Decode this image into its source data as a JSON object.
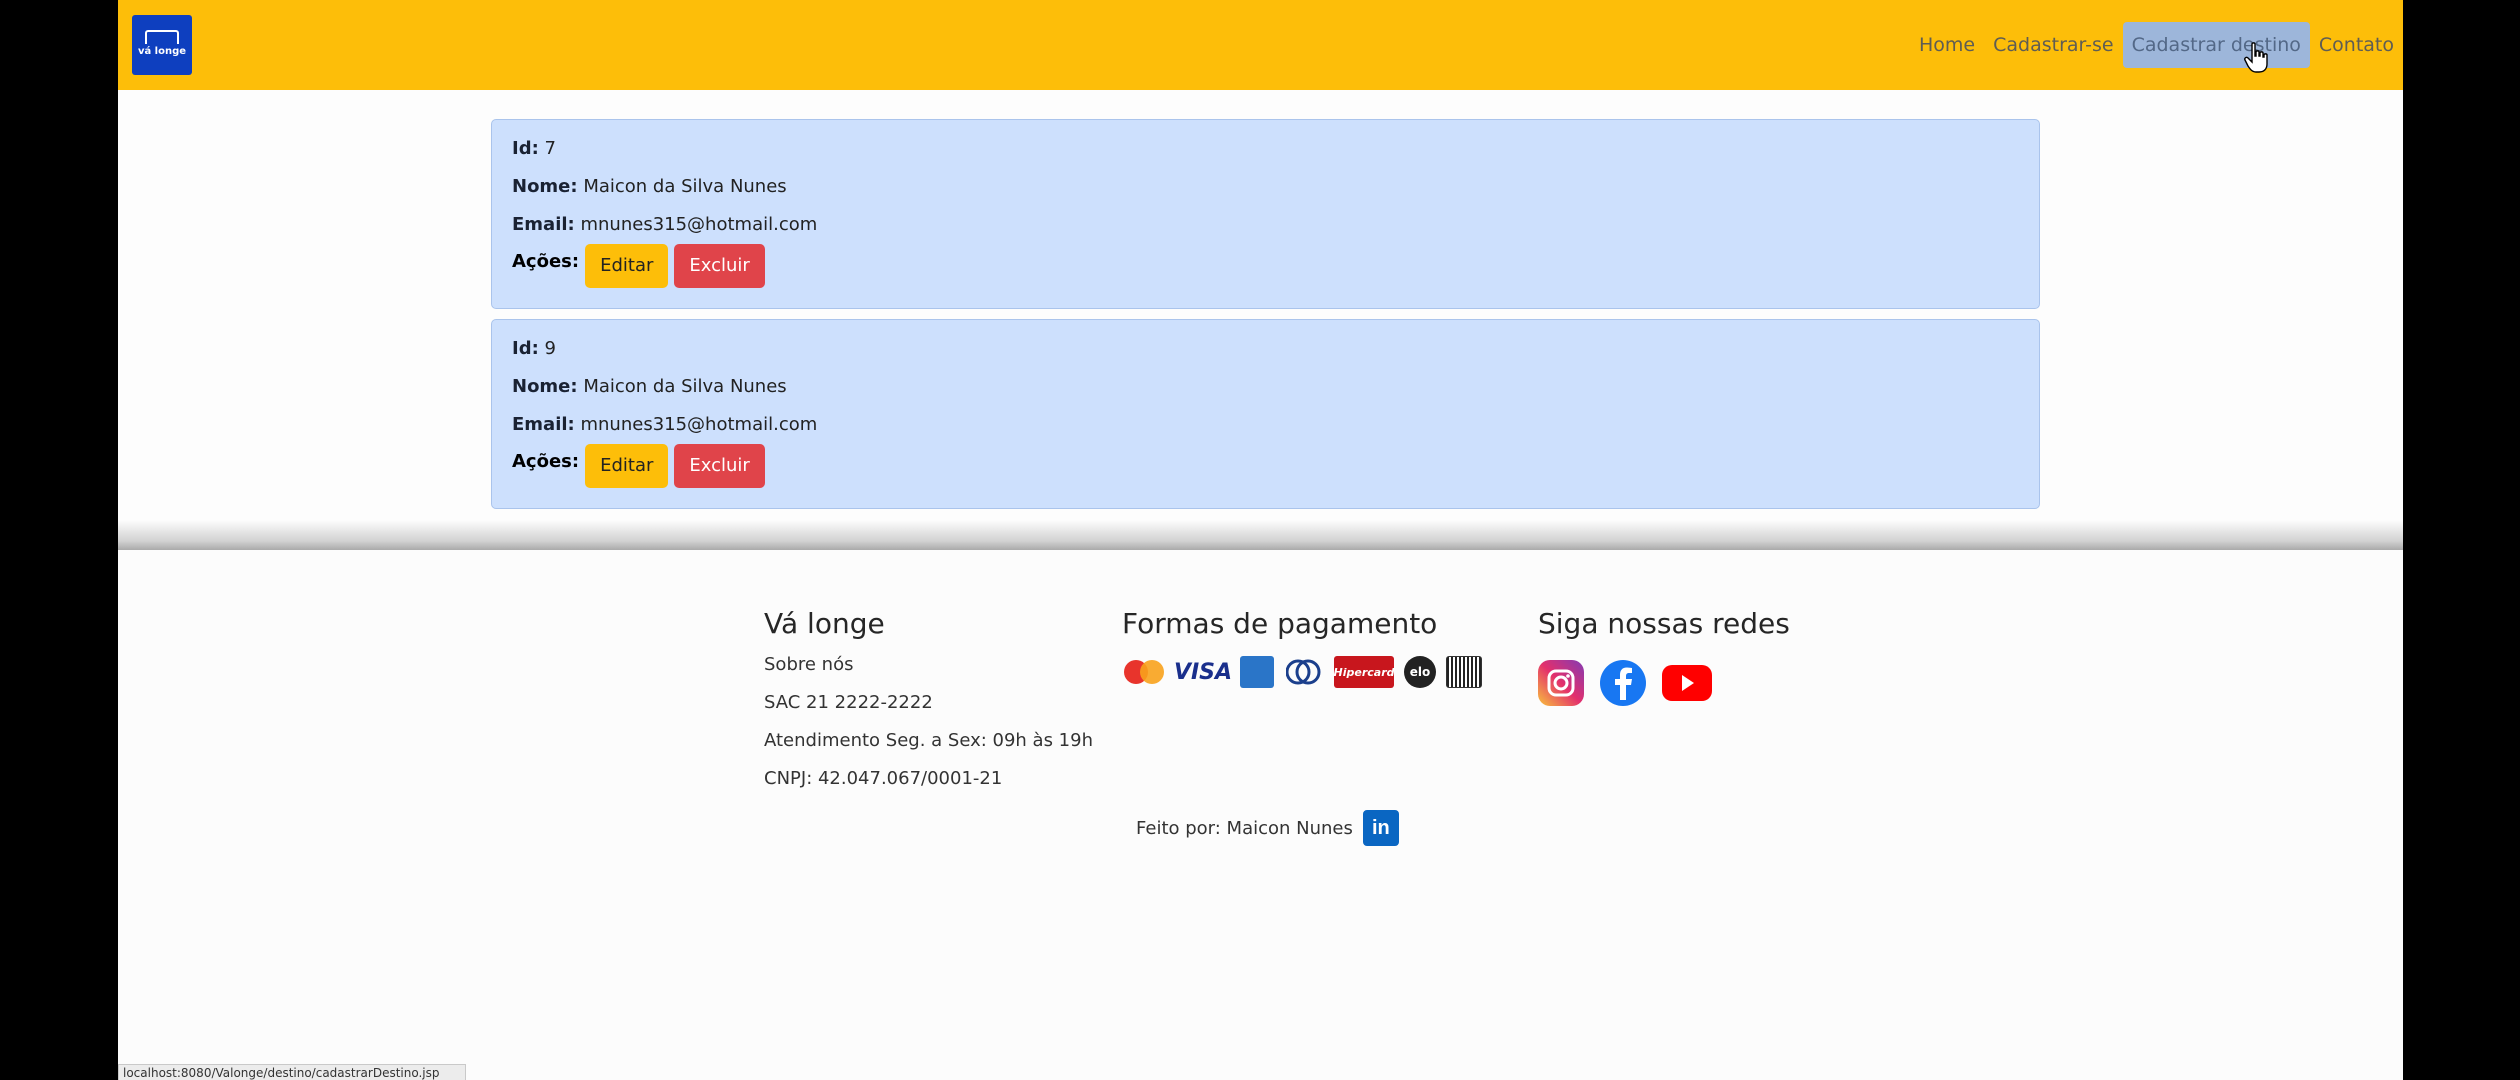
{
  "navbar": {
    "logo_text": "vá longe",
    "links": [
      {
        "label": "Home"
      },
      {
        "label": "Cadastrar-se"
      },
      {
        "label": "Cadastrar destino"
      },
      {
        "label": "Contato"
      }
    ]
  },
  "records": [
    {
      "id_label": "Id:",
      "id": "7",
      "name_label": "Nome:",
      "name": "Maicon da Silva Nunes",
      "email_label": "Email:",
      "email": "mnunes315@hotmail.com",
      "actions_label": "Ações:",
      "edit_label": "Editar",
      "delete_label": "Excluir"
    },
    {
      "id_label": "Id:",
      "id": "9",
      "name_label": "Nome:",
      "name": "Maicon da Silva Nunes",
      "email_label": "Email:",
      "email": "mnunes315@hotmail.com",
      "actions_label": "Ações:",
      "edit_label": "Editar",
      "delete_label": "Excluir"
    }
  ],
  "footer": {
    "about": {
      "title": "Vá longe",
      "lines": [
        "Sobre nós",
        "SAC 21 2222-2222",
        "Atendimento Seg. a Sex: 09h às 19h",
        "CNPJ: 42.047.067/0001-21"
      ]
    },
    "payment": {
      "title": "Formas de pagamento",
      "methods": [
        "mastercard-icon",
        "visa-icon",
        "amex-icon",
        "diners-icon",
        "hipercard-icon",
        "elo-icon",
        "boleto-icon"
      ],
      "visa_text": "VISA",
      "hipercard_text": "Hipercard",
      "elo_text": "elo"
    },
    "social": {
      "title": "Siga nossas redes",
      "icons": [
        "instagram-icon",
        "facebook-icon",
        "youtube-icon"
      ]
    },
    "made_by": "Feito por: Maicon Nunes"
  },
  "status_bar": "localhost:8080/Valonge/destino/cadastrarDestino.jsp",
  "colors": {
    "navbar": "#fdbe09",
    "card_bg": "#cde0fd",
    "edit_button": "#fdbe09",
    "delete_button": "#e0444a",
    "active_link_bg": "#9db6da"
  }
}
